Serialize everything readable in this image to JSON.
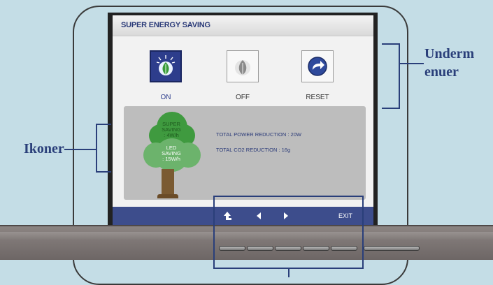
{
  "osd": {
    "title": "SUPER ENERGY SAVING",
    "modes": [
      {
        "label": "ON",
        "icon": "leaf-rays-icon",
        "selected": true
      },
      {
        "label": "OFF",
        "icon": "leaf-icon",
        "selected": false
      },
      {
        "label": "RESET",
        "icon": "reset-arrow-icon",
        "selected": false
      }
    ],
    "tree": {
      "super_line1": "SUPER",
      "super_line2": "SAVING",
      "super_line3": ": 4W/h",
      "led_line1": "LED",
      "led_line2": "SAVING",
      "led_line3": ": 15W/h"
    },
    "stats": {
      "power": "TOTAL POWER REDUCTION : 20W",
      "co2": "TOTAL CO2 REDUCTION : 16g"
    },
    "nav": {
      "up_icon": "up-return-icon",
      "left_icon": "left-arrow-icon",
      "right_icon": "right-arrow-icon",
      "exit_label": "EXIT"
    }
  },
  "callouts": {
    "icons_label": "Ikoner",
    "submenu_label_line1": "Underm",
    "submenu_label_line2": "enuer"
  },
  "colors": {
    "accent": "#2d3d8c",
    "callout": "#2a3f7a",
    "background": "#c4dde6"
  }
}
